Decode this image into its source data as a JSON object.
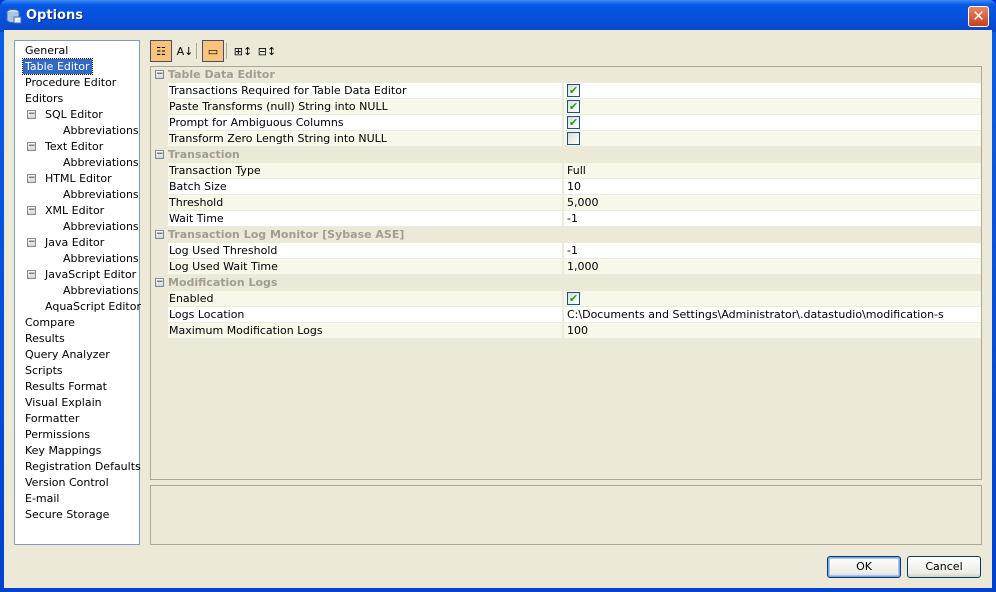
{
  "window": {
    "title": "Options",
    "close_label": "✕"
  },
  "tree": [
    {
      "label": "General",
      "level": 0
    },
    {
      "label": "Table Editor",
      "level": 0,
      "selected": true
    },
    {
      "label": "Procedure Editor",
      "level": 0
    },
    {
      "label": "Editors",
      "level": 0
    },
    {
      "label": "SQL Editor",
      "level": 1,
      "expanded": true
    },
    {
      "label": "Abbreviations",
      "level": 2
    },
    {
      "label": "Text Editor",
      "level": 1,
      "expanded": true
    },
    {
      "label": "Abbreviations",
      "level": 2
    },
    {
      "label": "HTML Editor",
      "level": 1,
      "expanded": true
    },
    {
      "label": "Abbreviations",
      "level": 2
    },
    {
      "label": "XML Editor",
      "level": 1,
      "expanded": true
    },
    {
      "label": "Abbreviations",
      "level": 2
    },
    {
      "label": "Java Editor",
      "level": 1,
      "expanded": true
    },
    {
      "label": "Abbreviations",
      "level": 2
    },
    {
      "label": "JavaScript Editor",
      "level": 1,
      "expanded": true
    },
    {
      "label": "Abbreviations",
      "level": 2
    },
    {
      "label": "AquaScript Editor",
      "level": 1
    },
    {
      "label": "Compare",
      "level": 0
    },
    {
      "label": "Results",
      "level": 0
    },
    {
      "label": "Query Analyzer",
      "level": 0
    },
    {
      "label": "Scripts",
      "level": 0
    },
    {
      "label": "Results Format",
      "level": 0
    },
    {
      "label": "Visual Explain",
      "level": 0
    },
    {
      "label": "Formatter",
      "level": 0
    },
    {
      "label": "Permissions",
      "level": 0
    },
    {
      "label": "Key Mappings",
      "level": 0
    },
    {
      "label": "Registration Defaults",
      "level": 0
    },
    {
      "label": "Version Control",
      "level": 0
    },
    {
      "label": "E-mail",
      "level": 0
    },
    {
      "label": "Secure Storage",
      "level": 0
    }
  ],
  "toolbar": [
    {
      "icon": "categorized-icon",
      "active": true
    },
    {
      "icon": "sort-alphabetical-icon",
      "active": false
    },
    {
      "icon": "description-toggle-icon",
      "active": true
    },
    {
      "icon": "expand-all-icon",
      "active": false
    },
    {
      "icon": "collapse-all-icon",
      "active": false
    }
  ],
  "groups": [
    {
      "title": "Table Data Editor",
      "rows": [
        {
          "name": "Transactions Required for Table Data Editor",
          "checkbox": true,
          "checked": true
        },
        {
          "name": "Paste Transforms (null) String into NULL",
          "checkbox": true,
          "checked": true
        },
        {
          "name": "Prompt for Ambiguous Columns",
          "checkbox": true,
          "checked": true
        },
        {
          "name": "Transform Zero Length String into NULL",
          "checkbox": true,
          "checked": false
        }
      ]
    },
    {
      "title": "Transaction",
      "rows": [
        {
          "name": "Transaction Type",
          "value": "Full"
        },
        {
          "name": "Batch Size",
          "value": "10"
        },
        {
          "name": "Threshold",
          "value": "5,000"
        },
        {
          "name": "Wait Time",
          "value": "-1"
        }
      ]
    },
    {
      "title": "Transaction Log Monitor [Sybase ASE]",
      "rows": [
        {
          "name": "Log Used Threshold",
          "value": "-1"
        },
        {
          "name": "Log Used Wait Time",
          "value": "1,000"
        }
      ]
    },
    {
      "title": "Modification Logs",
      "rows": [
        {
          "name": "Enabled",
          "checkbox": true,
          "checked": true
        },
        {
          "name": "Logs Location",
          "value": "C:\\Documents and Settings\\Administrator\\.datastudio\\modification-s"
        },
        {
          "name": "Maximum Modification Logs",
          "value": "100"
        }
      ]
    }
  ],
  "buttons": {
    "ok": "OK",
    "cancel": "Cancel"
  }
}
